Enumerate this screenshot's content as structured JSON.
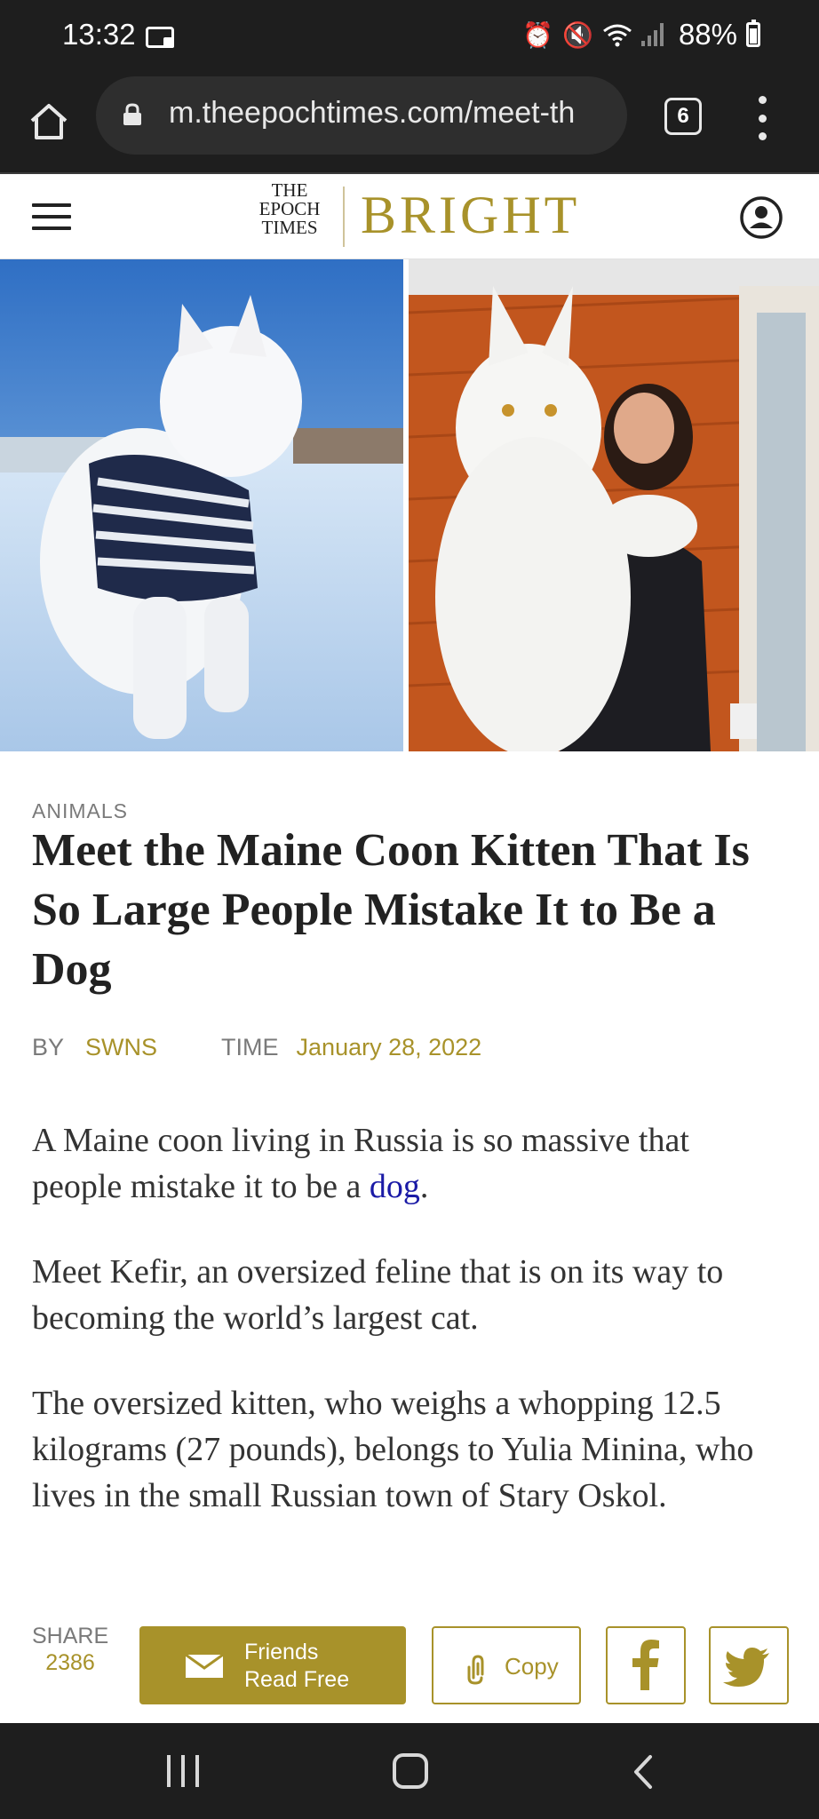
{
  "status_bar": {
    "time": "13:32",
    "battery": "88%",
    "icons": [
      "alarm-icon",
      "mute-icon",
      "wifi-icon",
      "signal-icon",
      "battery-icon"
    ]
  },
  "browser": {
    "url": "m.theepochtimes.com/meet-th",
    "tab_count": "6"
  },
  "site": {
    "logo_line1": "THE",
    "logo_line2": "EPOCH",
    "logo_line3": "TIMES",
    "section_brand": "BRIGHT",
    "brand_color": "#a8922a"
  },
  "article": {
    "category": "ANIMALS",
    "headline": "Meet the Maine Coon Kitten That Is So Large People Mistake It to Be a Dog",
    "by_label": "BY",
    "author": "SWNS",
    "time_label": "TIME",
    "date": "January 28, 2022",
    "p1_before": "A Maine coon living in Russia is so massive that people mistake it to be a ",
    "p1_link": "dog",
    "p1_after": ".",
    "p2": "Meet Kefir, an oversized feline that is on its way to becoming the world’s largest cat.",
    "p3": "The oversized kitten, who weighs a whopping 12.5 kilograms (27 pounds), belongs to Yulia Minina, who lives in the small Russian town of Stary Oskol."
  },
  "share": {
    "label": "SHARE",
    "count": "2386",
    "friends_line1": "Friends",
    "friends_line2": "Read Free",
    "copy_label": "Copy"
  }
}
